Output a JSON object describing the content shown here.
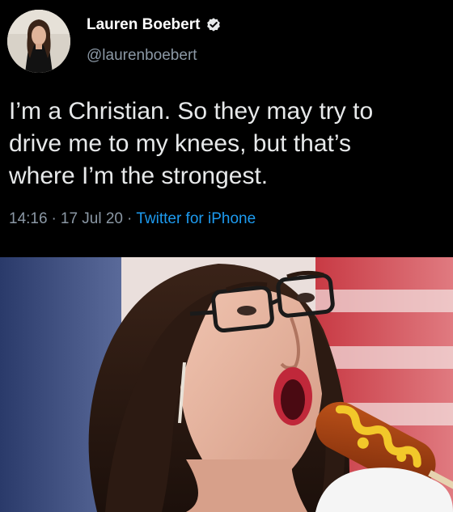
{
  "author": {
    "display_name": "Lauren Boebert",
    "handle": "@laurenboebert",
    "verified": true,
    "avatar_icon": "profile-avatar"
  },
  "tweet": {
    "lines": [
      "I’m a Christian. So they may try to",
      "drive me to my knees, but that’s",
      "where I’m the strongest."
    ],
    "time": "14:16",
    "separator": "·",
    "date": "17 Jul 20",
    "source": "Twitter for iPhone"
  },
  "colors": {
    "background": "#000000",
    "text": "#e7e9ea",
    "secondary": "#8b98a5",
    "link": "#1d9bf0",
    "verified_badge": "#e7e9ea"
  },
  "photo": {
    "description_icon": "meme-photo"
  }
}
